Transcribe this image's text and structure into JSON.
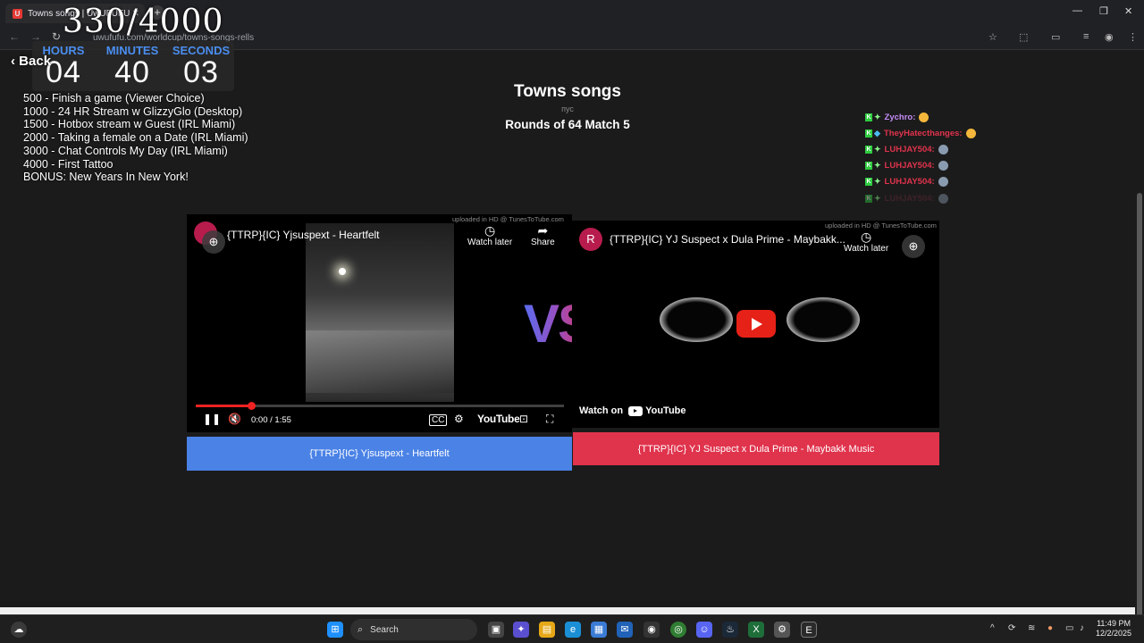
{
  "browser": {
    "tab_title": "Towns songs | UwUFUFU",
    "tab_favicon": "U",
    "url": "uwufufu.com/worldcup/towns-songs-rells",
    "new_tab": "+"
  },
  "stream_overlay": {
    "counter": "330/4000",
    "timer": {
      "hours_label": "HOURS",
      "hours": "04",
      "minutes_label": "MINUTES",
      "minutes": "40",
      "seconds_label": "SECONDS",
      "seconds": "03"
    },
    "goals": [
      " 500 -  Finish a game (Viewer Choice)",
      "1000 - 24 HR Stream w GlizzyGlo (Desktop)",
      "1500 - Hotbox stream w Guest (IRL Miami)",
      "2000 - Taking a female on a Date (IRL Miami)",
      "3000 - Chat Controls My Day (IRL Miami)",
      "4000 - First Tattoo",
      "BONUS: New Years In New York!"
    ],
    "chat": [
      {
        "user": "Zychro:",
        "color": "#c48cf5"
      },
      {
        "user": "TheyHatecthanges:",
        "color": "#e0334c"
      },
      {
        "user": "LUHJAY504:",
        "color": "#e0334c"
      },
      {
        "user": "LUHJAY504:",
        "color": "#e0334c"
      },
      {
        "user": "LUHJAY504:",
        "color": "#e0334c"
      },
      {
        "user": "LUHJAY504:",
        "color": "#6b2a38"
      }
    ]
  },
  "page": {
    "back_label": "Back",
    "title": "Towns songs",
    "subtitle": "пус",
    "round": "Rounds of 64 Match 5",
    "vs": "VS"
  },
  "left_video": {
    "title": "{TTRP}{IC} Yjsuspext - Heartfelt",
    "uploaded": "uploaded in HD @ TunesToTube.com",
    "watch_later": "Watch later",
    "share": "Share",
    "time": "0:00 / 1:55",
    "youtube": "YouTube",
    "progress": 0.15,
    "vote_label": "{TTRP}{IC} Yjsuspext - Heartfelt",
    "vote_color": "#4a82e6"
  },
  "right_video": {
    "avatar": "R",
    "title": "{TTRP}{IC} YJ Suspect x Dula Prime - Maybakk...",
    "uploaded": "uploaded in HD @ TunesToTube.com",
    "watch_later": "Watch later",
    "watch_on": "Watch on",
    "youtube": "YouTube",
    "vote_label": "{TTRP}{IC} YJ Suspect x Dula Prime - Maybakk Music",
    "vote_color": "#e0334c"
  },
  "taskbar": {
    "search_label": "Search",
    "time": "11:49 PM",
    "date": "12/2/2025"
  }
}
